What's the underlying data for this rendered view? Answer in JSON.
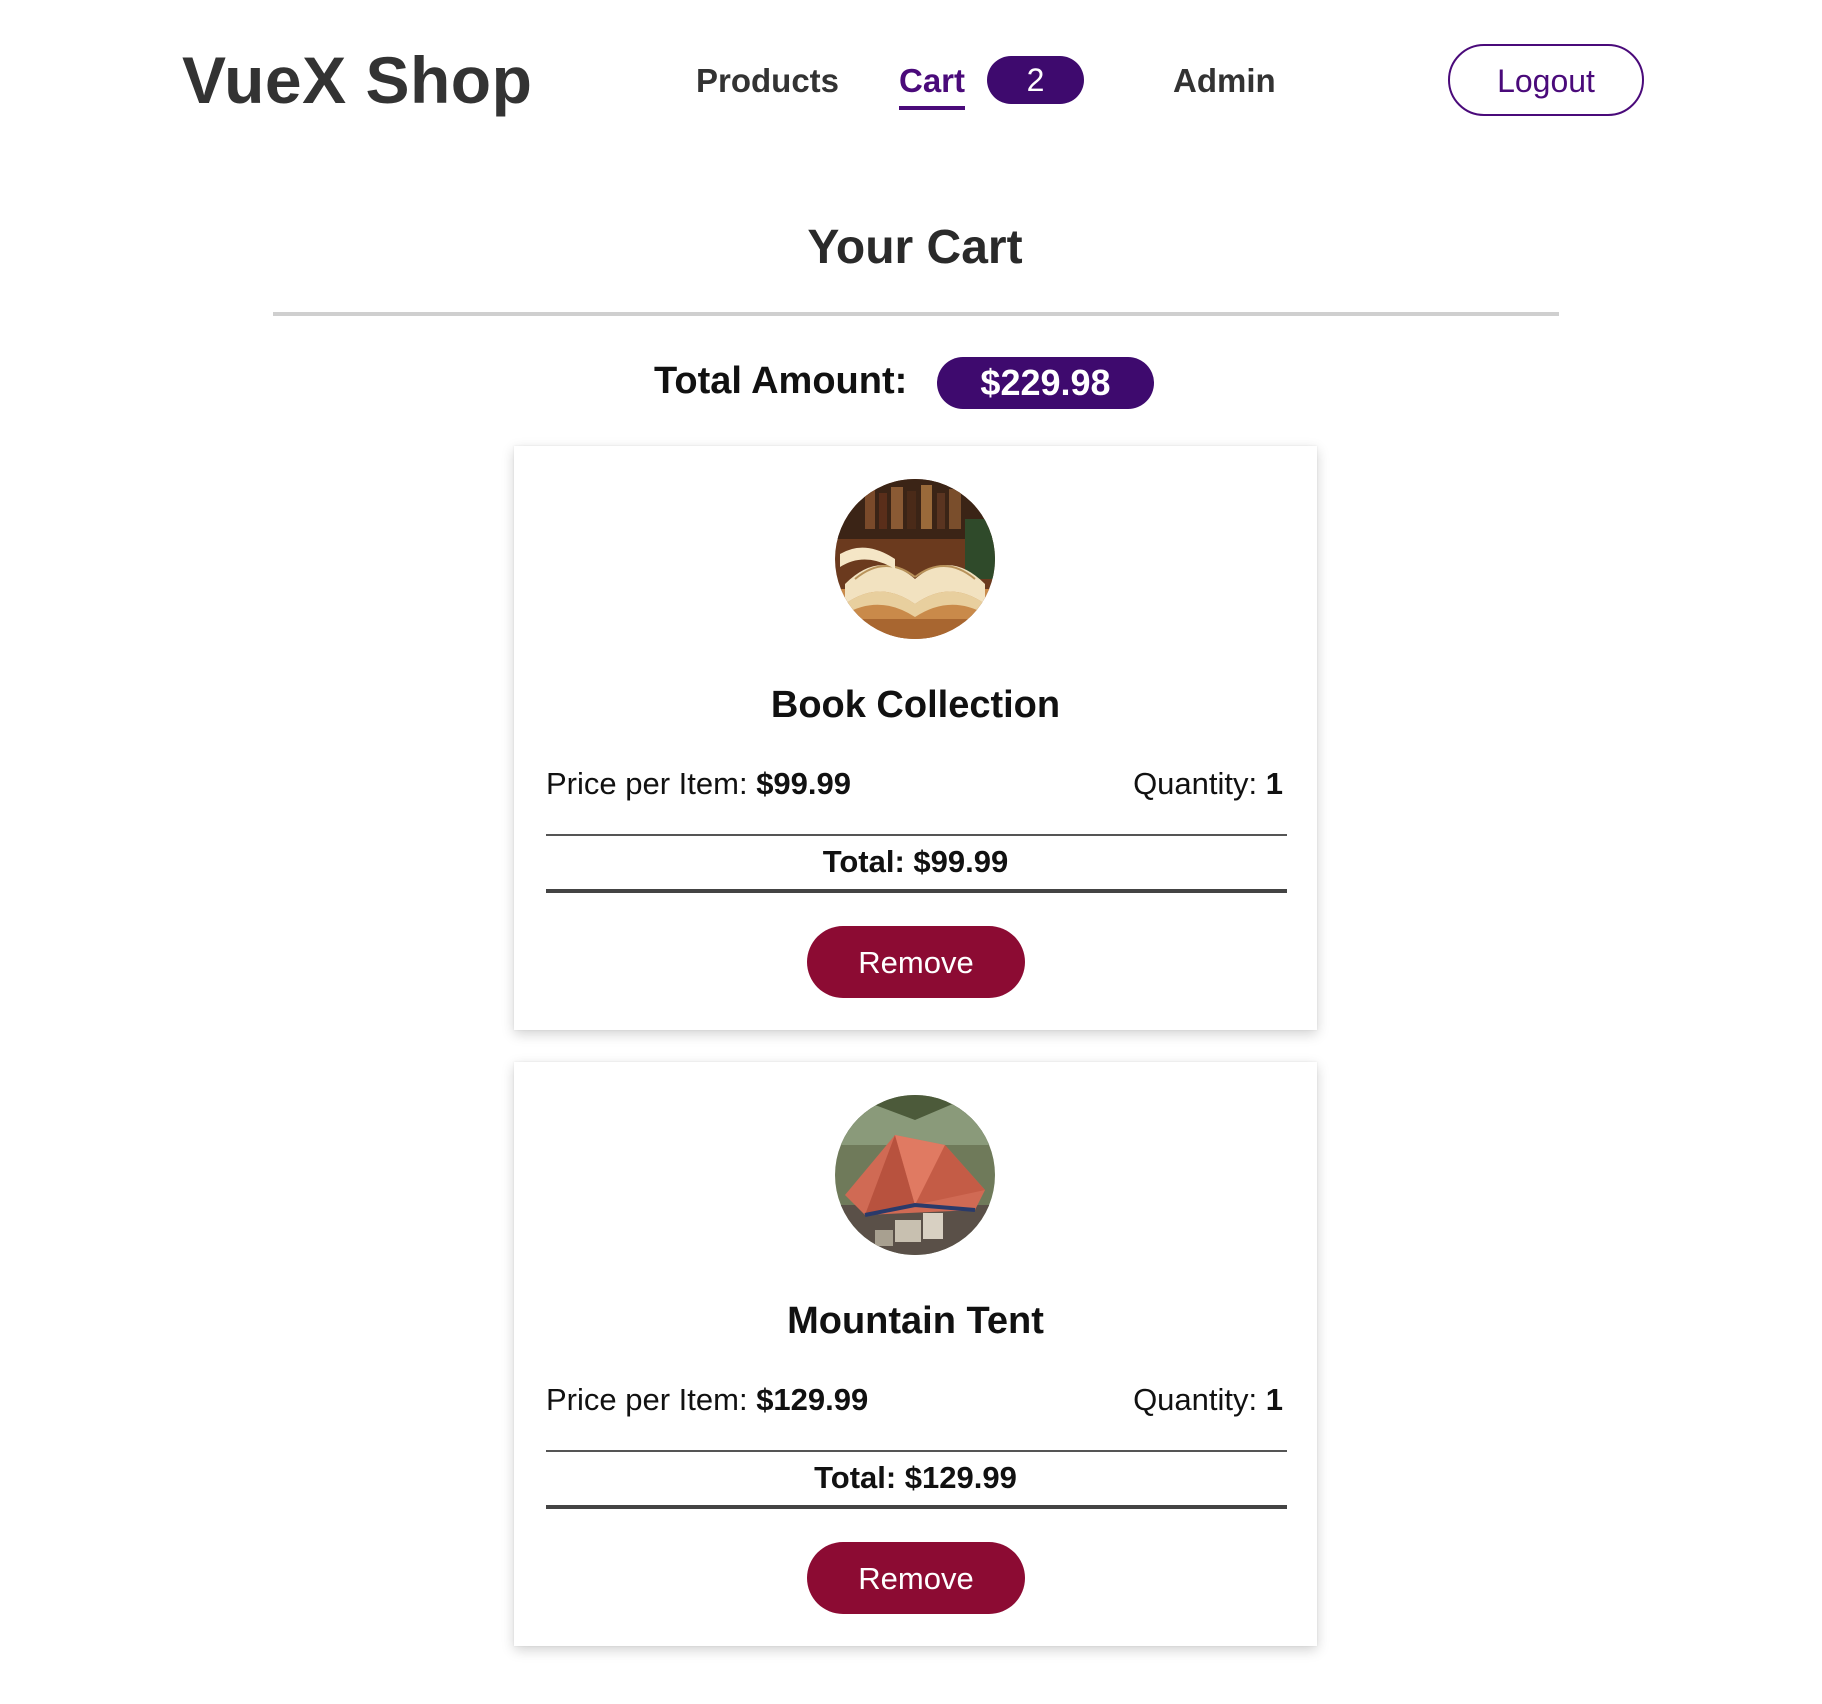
{
  "header": {
    "brand": "VueX Shop",
    "nav": {
      "products": "Products",
      "cart": "Cart",
      "cart_count": "2",
      "admin": "Admin"
    },
    "logout": "Logout"
  },
  "main": {
    "title": "Your Cart",
    "total_label": "Total Amount:",
    "total_value": "$229.98"
  },
  "items": [
    {
      "name": "Book Collection",
      "price_label": "Price per Item:",
      "price": "$99.99",
      "quantity_label": "Quantity:",
      "quantity": "1",
      "total": "Total: $99.99",
      "remove": "Remove",
      "image_icon": "open-book-photo"
    },
    {
      "name": "Mountain Tent",
      "price_label": "Price per Item:",
      "price": "$129.99",
      "quantity_label": "Quantity:",
      "quantity": "1",
      "total": "Total: $129.99",
      "remove": "Remove",
      "image_icon": "red-tent-photo"
    }
  ],
  "colors": {
    "accent": "#4a0a7a",
    "badge": "#3e0a6e",
    "remove": "#8c0b33"
  }
}
